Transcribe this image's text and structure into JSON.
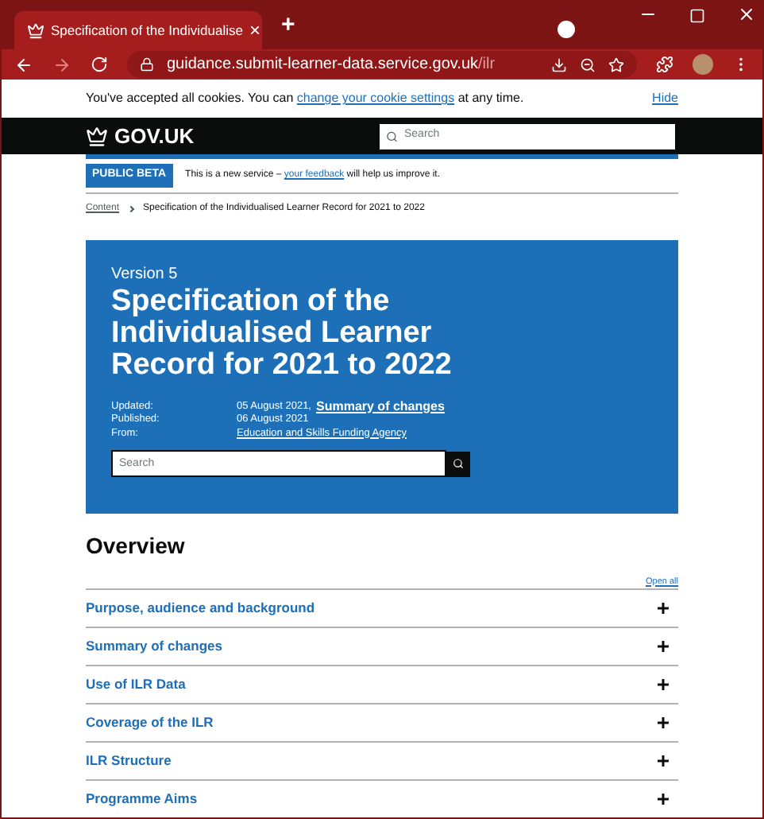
{
  "browser": {
    "tab_title": "Specification of the Individualise",
    "tab_close": "×",
    "new_tab": "+",
    "url_host": "guidance.submit-learner-data.service.gov.uk",
    "url_path": "/ilr"
  },
  "cookie_banner": {
    "before": "You've accepted all cookies. You can",
    "link": "change your cookie settings",
    "after": "at any time.",
    "hide": "Hide"
  },
  "header": {
    "logo": "GOV.UK",
    "search_placeholder": "Search"
  },
  "phase_banner": {
    "tag": "PUBLIC BETA",
    "before": "This is a new service –",
    "link": "your feedback",
    "after": "will help us improve it."
  },
  "breadcrumbs": [
    {
      "label": "Content",
      "kind": "link"
    },
    {
      "label": "Specification of the Individualised Learner Record for 2021 to 2022",
      "kind": "current"
    }
  ],
  "hero": {
    "caption": "Version 5",
    "title": "Specification of the Individualised Learner Record for 2021 to 2022",
    "metadata": [
      {
        "label": "Updated:",
        "value": "05 August 2021,",
        "link": "Summary of changes"
      },
      {
        "label": "Published:",
        "value": "06 August 2021"
      },
      {
        "label": "From:",
        "link": "Education and Skills Funding Agency"
      }
    ],
    "search_placeholder": "Search"
  },
  "overview": {
    "heading": "Overview",
    "open_all": "Open all",
    "sections": [
      {
        "title": "Purpose, audience and background",
        "expanded": false
      },
      {
        "title": "Summary of changes",
        "expanded": false
      },
      {
        "title": "Use of ILR Data",
        "expanded": false
      },
      {
        "title": "Coverage of the ILR",
        "expanded": false
      },
      {
        "title": "ILR Structure",
        "expanded": false
      },
      {
        "title": "Programme Aims",
        "expanded": false
      }
    ]
  }
}
